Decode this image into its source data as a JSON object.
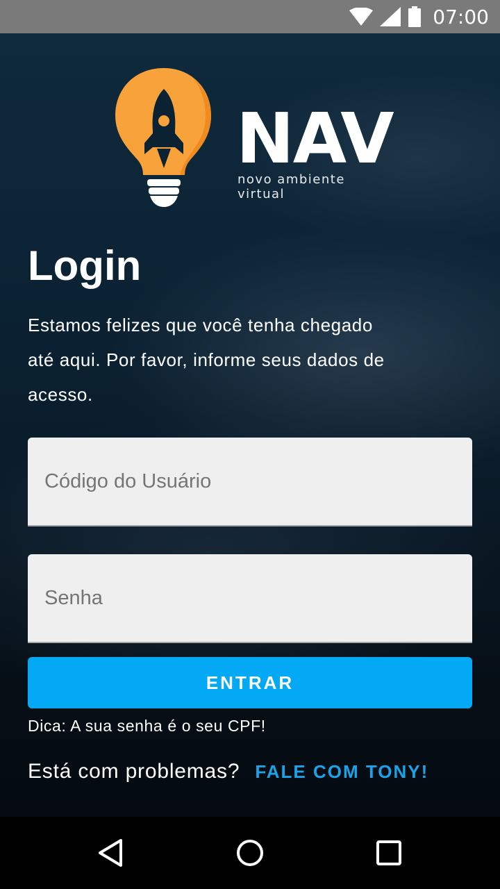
{
  "status_bar": {
    "time": "07:00",
    "icons": [
      "wifi-icon",
      "signal-icon",
      "battery-icon"
    ]
  },
  "logo": {
    "wordmark": "NAV",
    "tagline": "novo ambiente virtual",
    "icon": "rocket-lightbulb-icon",
    "bulb_color": "#f7a23b"
  },
  "login": {
    "title": "Login",
    "intro": "Estamos felizes que você tenha chegado até aqui. Por favor, informe seus dados de acesso.",
    "user_field": {
      "placeholder": "Código do Usuário",
      "value": ""
    },
    "password_field": {
      "placeholder": "Senha",
      "value": ""
    },
    "submit_label": "ENTRAR",
    "tip": "Dica: A sua senha é o seu CPF!",
    "help_question": "Está com problemas?",
    "help_link": "FALE COM TONY!"
  },
  "nav_bar": {
    "buttons": [
      "back-icon",
      "home-icon",
      "recent-apps-icon"
    ]
  },
  "colors": {
    "accent": "#03a9f4",
    "link": "#1aa3e8",
    "logo_orange": "#f7a23b"
  }
}
